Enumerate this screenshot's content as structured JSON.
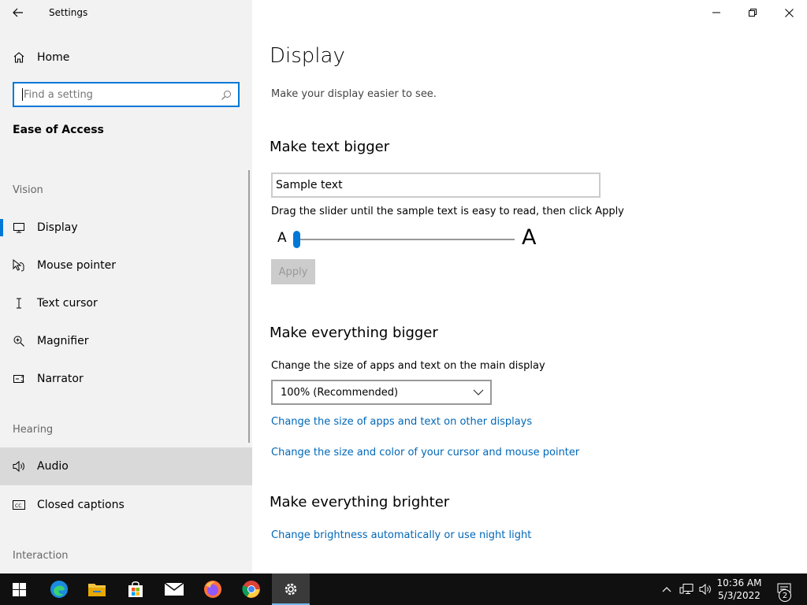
{
  "window": {
    "title": "Settings"
  },
  "sidebar": {
    "home_label": "Home",
    "search_placeholder": "Find a setting",
    "category": "Ease of Access",
    "sections": {
      "vision": "Vision",
      "hearing": "Hearing",
      "interaction": "Interaction"
    },
    "items": [
      {
        "label": "Display",
        "icon": "monitor-icon",
        "selected": true
      },
      {
        "label": "Mouse pointer",
        "icon": "mouse-pointer-icon"
      },
      {
        "label": "Text cursor",
        "icon": "text-cursor-icon"
      },
      {
        "label": "Magnifier",
        "icon": "magnifier-icon"
      },
      {
        "label": "Narrator",
        "icon": "narrator-icon"
      },
      {
        "label": "Audio",
        "icon": "speaker-icon",
        "hovered": true
      },
      {
        "label": "Closed captions",
        "icon": "closed-captions-icon"
      }
    ]
  },
  "main": {
    "title": "Display",
    "subtitle": "Make your display easier to see.",
    "text_bigger": {
      "heading": "Make text bigger",
      "sample_text": "Sample text",
      "hint": "Drag the slider until the sample text is easy to read, then click Apply",
      "small_a": "A",
      "big_a": "A",
      "slider_value_percent": 0,
      "apply_label": "Apply"
    },
    "everything_bigger": {
      "heading": "Make everything bigger",
      "description": "Change the size of apps and text on the main display",
      "dropdown_value": "100% (Recommended)",
      "link_other_displays": "Change the size of apps and text on other displays",
      "link_cursor": "Change the size and color of your cursor and mouse pointer"
    },
    "everything_brighter": {
      "heading": "Make everything brighter",
      "link_brightness": "Change brightness automatically or use night light"
    }
  },
  "taskbar": {
    "apps": [
      "edge-icon",
      "file-explorer-icon",
      "store-icon",
      "mail-icon",
      "firefox-icon",
      "chrome-icon",
      "settings-icon"
    ],
    "active_app": "settings-icon",
    "time": "10:36 AM",
    "date": "5/3/2022",
    "notification_count": "2"
  },
  "colors": {
    "accent": "#0078d7",
    "link": "#0067b8",
    "sidebar_bg": "#f2f2f2",
    "taskbar_bg": "#101010"
  }
}
